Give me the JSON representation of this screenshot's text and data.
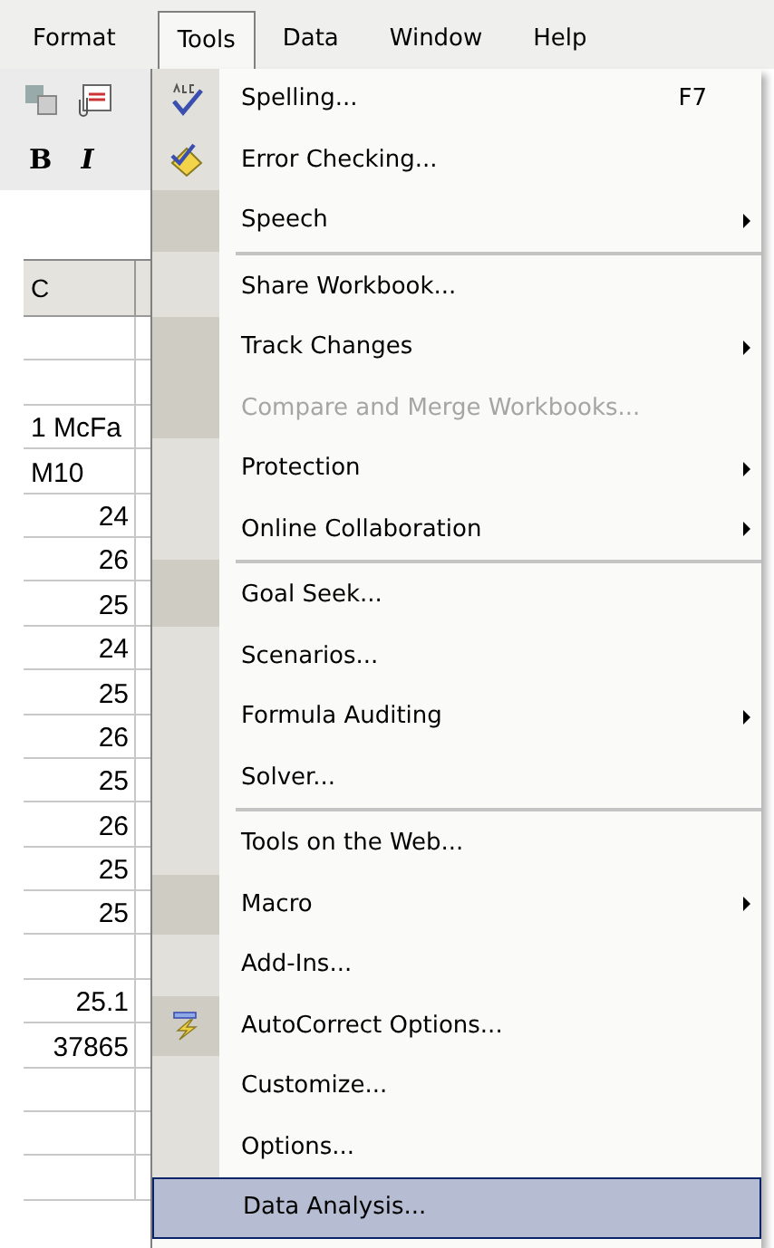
{
  "menubar": [
    {
      "label": "Format",
      "selected": false
    },
    {
      "label": "Tools",
      "selected": true
    },
    {
      "label": "Data",
      "selected": false
    },
    {
      "label": "Window",
      "selected": false
    },
    {
      "label": "Help",
      "selected": false
    }
  ],
  "toolbar": {
    "format_buttons": [
      "B",
      "I"
    ]
  },
  "sheet": {
    "column_header": "C",
    "cells": [
      {
        "kind": "blank"
      },
      {
        "kind": "blank"
      },
      {
        "kind": "text",
        "text": "1 McFa"
      },
      {
        "kind": "text",
        "text": "M10"
      },
      {
        "kind": "number",
        "text": "24"
      },
      {
        "kind": "number",
        "text": "26"
      },
      {
        "kind": "number",
        "text": "25"
      },
      {
        "kind": "number",
        "text": "24"
      },
      {
        "kind": "number",
        "text": "25"
      },
      {
        "kind": "number",
        "text": "26"
      },
      {
        "kind": "number",
        "text": "25"
      },
      {
        "kind": "number",
        "text": "26"
      },
      {
        "kind": "number",
        "text": "25"
      },
      {
        "kind": "number",
        "text": "25"
      },
      {
        "kind": "blank"
      },
      {
        "kind": "number",
        "text": "25.1"
      },
      {
        "kind": "number",
        "text": "37865"
      },
      {
        "kind": "blank"
      },
      {
        "kind": "blank"
      },
      {
        "kind": "blank"
      }
    ]
  },
  "menu": {
    "items": [
      {
        "label": "Spelling...",
        "shortcut": "F7",
        "submenu": false,
        "disabled": false,
        "selected": false,
        "rarely_used": false,
        "separator_before": false
      },
      {
        "label": "Error Checking...",
        "submenu": false,
        "disabled": false,
        "selected": false,
        "rarely_used": false,
        "separator_before": false
      },
      {
        "label": "Speech",
        "submenu": true,
        "disabled": false,
        "selected": false,
        "rarely_used": true,
        "separator_before": false
      },
      {
        "label": "Share Workbook...",
        "submenu": false,
        "disabled": false,
        "selected": false,
        "rarely_used": false,
        "separator_before": true
      },
      {
        "label": "Track Changes",
        "submenu": true,
        "disabled": false,
        "selected": false,
        "rarely_used": true,
        "separator_before": false
      },
      {
        "label": "Compare and Merge Workbooks...",
        "submenu": false,
        "disabled": true,
        "selected": false,
        "rarely_used": true,
        "separator_before": false
      },
      {
        "label": "Protection",
        "submenu": true,
        "disabled": false,
        "selected": false,
        "rarely_used": false,
        "separator_before": false
      },
      {
        "label": "Online Collaboration",
        "submenu": true,
        "disabled": false,
        "selected": false,
        "rarely_used": false,
        "separator_before": false
      },
      {
        "label": "Goal Seek...",
        "submenu": false,
        "disabled": false,
        "selected": false,
        "rarely_used": true,
        "separator_before": true
      },
      {
        "label": "Scenarios...",
        "submenu": false,
        "disabled": false,
        "selected": false,
        "rarely_used": false,
        "separator_before": false
      },
      {
        "label": "Formula Auditing",
        "submenu": true,
        "disabled": false,
        "selected": false,
        "rarely_used": false,
        "separator_before": false
      },
      {
        "label": "Solver...",
        "submenu": false,
        "disabled": false,
        "selected": false,
        "rarely_used": false,
        "separator_before": false
      },
      {
        "label": "Tools on the Web...",
        "submenu": false,
        "disabled": false,
        "selected": false,
        "rarely_used": false,
        "separator_before": true
      },
      {
        "label": "Macro",
        "submenu": true,
        "disabled": false,
        "selected": false,
        "rarely_used": true,
        "separator_before": false
      },
      {
        "label": "Add-Ins...",
        "submenu": false,
        "disabled": false,
        "selected": false,
        "rarely_used": false,
        "separator_before": false
      },
      {
        "label": "AutoCorrect Options...",
        "submenu": false,
        "disabled": false,
        "selected": false,
        "rarely_used": true,
        "separator_before": false
      },
      {
        "label": "Customize...",
        "submenu": false,
        "disabled": false,
        "selected": false,
        "rarely_used": false,
        "separator_before": false
      },
      {
        "label": "Options...",
        "submenu": false,
        "disabled": false,
        "selected": false,
        "rarely_used": false,
        "separator_before": false
      },
      {
        "label": "Data Analysis...",
        "submenu": false,
        "disabled": false,
        "selected": true,
        "rarely_used": false,
        "separator_before": false
      }
    ]
  }
}
